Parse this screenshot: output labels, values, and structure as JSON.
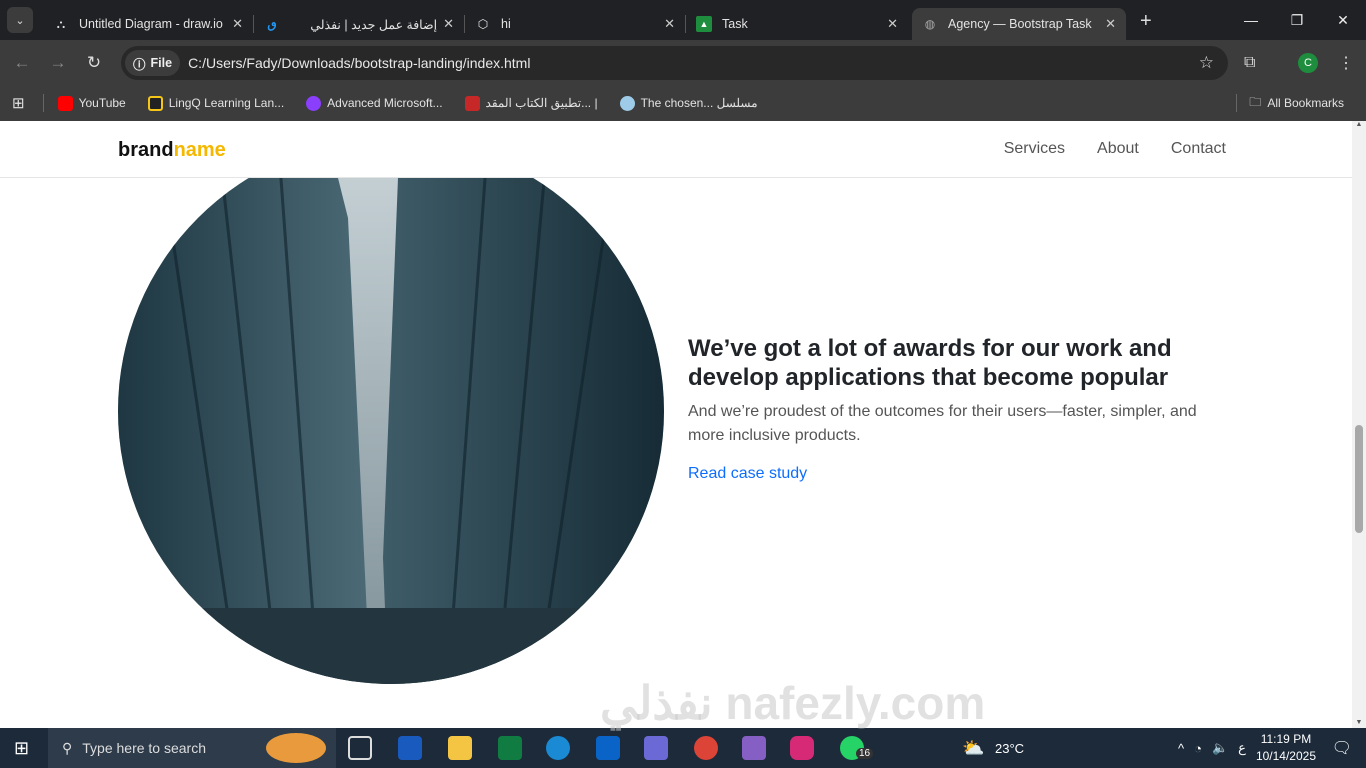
{
  "browser": {
    "tabs": [
      {
        "title": "Untitled Diagram - draw.io",
        "icon": "drawio-icon"
      },
      {
        "title": "إضافة عمل جديد | نفذلي",
        "icon": "nafezly-icon"
      },
      {
        "title": "hi",
        "icon": "hexagon-icon"
      },
      {
        "title": "Task",
        "icon": "classroom-icon"
      },
      {
        "title": "Agency — Bootstrap Task",
        "icon": "globe-icon",
        "active": true
      }
    ],
    "url_chip": "File",
    "url": "C:/Users/Fady/Downloads/bootstrap-landing/index.html",
    "profile_initial": "C",
    "bookmarks": [
      {
        "label": "YouTube",
        "color": "#ff0000"
      },
      {
        "label": "LingQ Learning Lan...",
        "color": "#f5c518"
      },
      {
        "label": "Advanced Microsoft...",
        "color": "#8a3ffc"
      },
      {
        "label": "تطبيق الكتاب المقد... |",
        "color": "#c62828"
      },
      {
        "label": "The chosen... مسلسل",
        "color": "#9ecbe8"
      }
    ],
    "all_bookmarks": "All Bookmarks"
  },
  "site": {
    "brand_a": "brand",
    "brand_b": "name",
    "brand_accent": "#f5b800",
    "nav": [
      "Services",
      "About",
      "Contact"
    ],
    "heading": "We’ve got a lot of awards for our work and develop applications that become popular",
    "text": "And we’re proudest of the outcomes for their users—faster, simpler, and more inclusive products.",
    "link": "Read case study",
    "link_color": "#0d6efd"
  },
  "taskbar": {
    "search_placeholder": "Type here to search",
    "weather": "23°C",
    "time": "11:19 PM",
    "date": "10/14/2025",
    "lang": "ع",
    "whatsapp_badge": "16"
  },
  "watermark": "نفذلي nafezly.com"
}
